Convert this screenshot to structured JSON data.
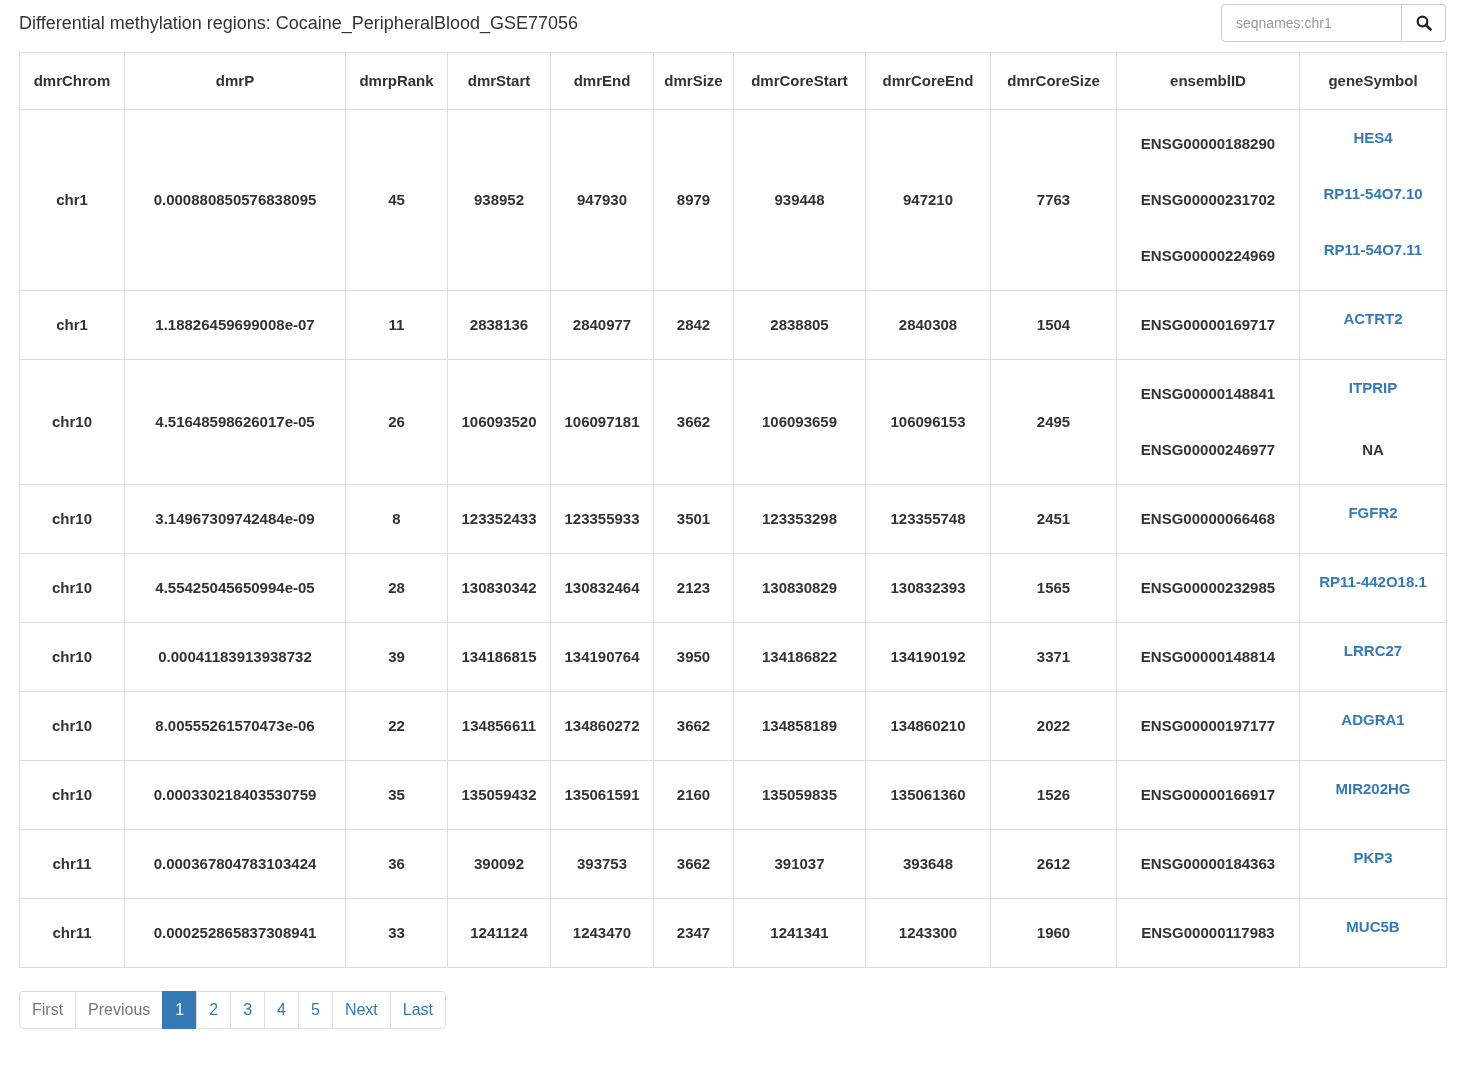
{
  "title": "Differential methylation regions: Cocaine_PeripheralBlood_GSE77056",
  "search": {
    "placeholder": "seqnames:chr1"
  },
  "table": {
    "columns": [
      "dmrChrom",
      "dmrP",
      "dmrpRank",
      "dmrStart",
      "dmrEnd",
      "dmrSize",
      "dmrCoreStart",
      "dmrCoreEnd",
      "dmrCoreSize",
      "ensemblID",
      "geneSymbol"
    ],
    "rows": [
      {
        "cells": [
          "chr1",
          "0.000880850576838095",
          "45",
          "938952",
          "947930",
          "8979",
          "939448",
          "947210",
          "7763"
        ],
        "genes": [
          {
            "ensembl": "ENSG00000188290",
            "symbol": "HES4",
            "link": true
          },
          {
            "ensembl": "ENSG00000231702",
            "symbol": "RP11-54O7.10",
            "link": true
          },
          {
            "ensembl": "ENSG00000224969",
            "symbol": "RP11-54O7.11",
            "link": true
          }
        ]
      },
      {
        "cells": [
          "chr1",
          "1.18826459699008e-07",
          "11",
          "2838136",
          "2840977",
          "2842",
          "2838805",
          "2840308",
          "1504"
        ],
        "genes": [
          {
            "ensembl": "ENSG00000169717",
            "symbol": "ACTRT2",
            "link": true
          }
        ]
      },
      {
        "cells": [
          "chr10",
          "4.51648598626017e-05",
          "26",
          "106093520",
          "106097181",
          "3662",
          "106093659",
          "106096153",
          "2495"
        ],
        "genes": [
          {
            "ensembl": "ENSG00000148841",
            "symbol": "ITPRIP",
            "link": true
          },
          {
            "ensembl": "ENSG00000246977",
            "symbol": "NA",
            "link": false
          }
        ]
      },
      {
        "cells": [
          "chr10",
          "3.14967309742484e-09",
          "8",
          "123352433",
          "123355933",
          "3501",
          "123353298",
          "123355748",
          "2451"
        ],
        "genes": [
          {
            "ensembl": "ENSG00000066468",
            "symbol": "FGFR2",
            "link": true
          }
        ]
      },
      {
        "cells": [
          "chr10",
          "4.55425045650994e-05",
          "28",
          "130830342",
          "130832464",
          "2123",
          "130830829",
          "130832393",
          "1565"
        ],
        "genes": [
          {
            "ensembl": "ENSG00000232985",
            "symbol": "RP11-442O18.1",
            "link": true
          }
        ]
      },
      {
        "cells": [
          "chr10",
          "0.00041183913938732",
          "39",
          "134186815",
          "134190764",
          "3950",
          "134186822",
          "134190192",
          "3371"
        ],
        "genes": [
          {
            "ensembl": "ENSG00000148814",
            "symbol": "LRRC27",
            "link": true
          }
        ]
      },
      {
        "cells": [
          "chr10",
          "8.00555261570473e-06",
          "22",
          "134856611",
          "134860272",
          "3662",
          "134858189",
          "134860210",
          "2022"
        ],
        "genes": [
          {
            "ensembl": "ENSG00000197177",
            "symbol": "ADGRA1",
            "link": true
          }
        ]
      },
      {
        "cells": [
          "chr10",
          "0.000330218403530759",
          "35",
          "135059432",
          "135061591",
          "2160",
          "135059835",
          "135061360",
          "1526"
        ],
        "genes": [
          {
            "ensembl": "ENSG00000166917",
            "symbol": "MIR202HG",
            "link": true
          }
        ]
      },
      {
        "cells": [
          "chr11",
          "0.000367804783103424",
          "36",
          "390092",
          "393753",
          "3662",
          "391037",
          "393648",
          "2612"
        ],
        "genes": [
          {
            "ensembl": "ENSG00000184363",
            "symbol": "PKP3",
            "link": true
          }
        ]
      },
      {
        "cells": [
          "chr11",
          "0.000252865837308941",
          "33",
          "1241124",
          "1243470",
          "2347",
          "1241341",
          "1243300",
          "1960"
        ],
        "genes": [
          {
            "ensembl": "ENSG00000117983",
            "symbol": "MUC5B",
            "link": true
          }
        ]
      }
    ]
  },
  "pagination": [
    {
      "label": "First",
      "selected": false,
      "disabled": true
    },
    {
      "label": "Previous",
      "selected": false,
      "disabled": true
    },
    {
      "label": "1",
      "selected": true,
      "disabled": false
    },
    {
      "label": "2",
      "selected": false,
      "disabled": false
    },
    {
      "label": "3",
      "selected": false,
      "disabled": false
    },
    {
      "label": "4",
      "selected": false,
      "disabled": false
    },
    {
      "label": "5",
      "selected": false,
      "disabled": false
    },
    {
      "label": "Next",
      "selected": false,
      "disabled": false
    },
    {
      "label": "Last",
      "selected": false,
      "disabled": false
    }
  ]
}
